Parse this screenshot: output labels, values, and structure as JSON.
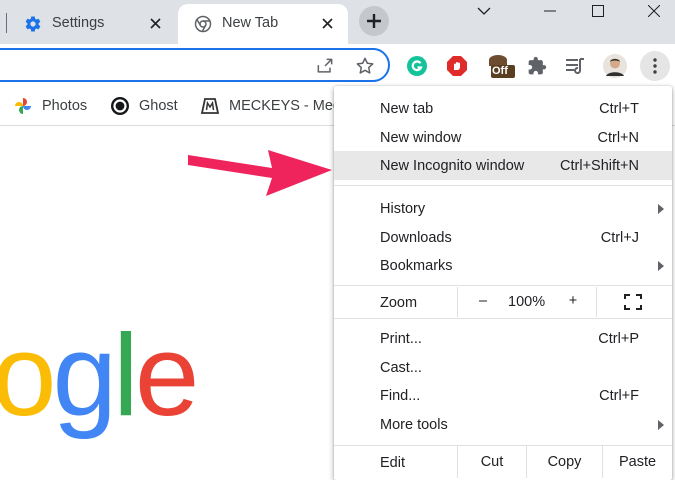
{
  "tabs": [
    {
      "title": "Settings",
      "icon": "settings-gear-icon",
      "active": false
    },
    {
      "title": "New Tab",
      "icon": "chrome-icon",
      "active": true
    }
  ],
  "window_controls": [
    "chevron-down-icon",
    "minimize-icon",
    "maximize-icon",
    "close-icon"
  ],
  "bookmarks": [
    {
      "label": "Photos",
      "icon": "google-photos-icon"
    },
    {
      "label": "Ghost",
      "icon": "ghost-icon"
    },
    {
      "label": "MECKEYS - Mec",
      "icon": "meckeys-icon"
    }
  ],
  "extensions": {
    "offline_badge": "Off"
  },
  "logo_letters": [
    {
      "char": "o",
      "color": "#fbbc05"
    },
    {
      "char": "g",
      "color": "#4285f4"
    },
    {
      "char": "l",
      "color": "#34a853"
    },
    {
      "char": "e",
      "color": "#ea4335"
    }
  ],
  "menu": {
    "new_tab": {
      "label": "New tab",
      "shortcut": "Ctrl+T"
    },
    "new_window": {
      "label": "New window",
      "shortcut": "Ctrl+N"
    },
    "new_incognito": {
      "label": "New Incognito window",
      "shortcut": "Ctrl+Shift+N"
    },
    "history": {
      "label": "History"
    },
    "downloads": {
      "label": "Downloads",
      "shortcut": "Ctrl+J"
    },
    "bookmarks": {
      "label": "Bookmarks"
    },
    "zoom": {
      "label": "Zoom",
      "minus": "–",
      "value": "100%",
      "plus": "+"
    },
    "print": {
      "label": "Print...",
      "shortcut": "Ctrl+P"
    },
    "cast": {
      "label": "Cast..."
    },
    "find": {
      "label": "Find...",
      "shortcut": "Ctrl+F"
    },
    "more_tools": {
      "label": "More tools"
    },
    "edit": {
      "label": "Edit",
      "cut": "Cut",
      "copy": "Copy",
      "paste": "Paste"
    }
  },
  "colors": {
    "accent": "#1a73e8",
    "annotation_arrow": "#f0245c",
    "tabstrip": "#dee1e6",
    "highlight": "#e8e8e9"
  }
}
